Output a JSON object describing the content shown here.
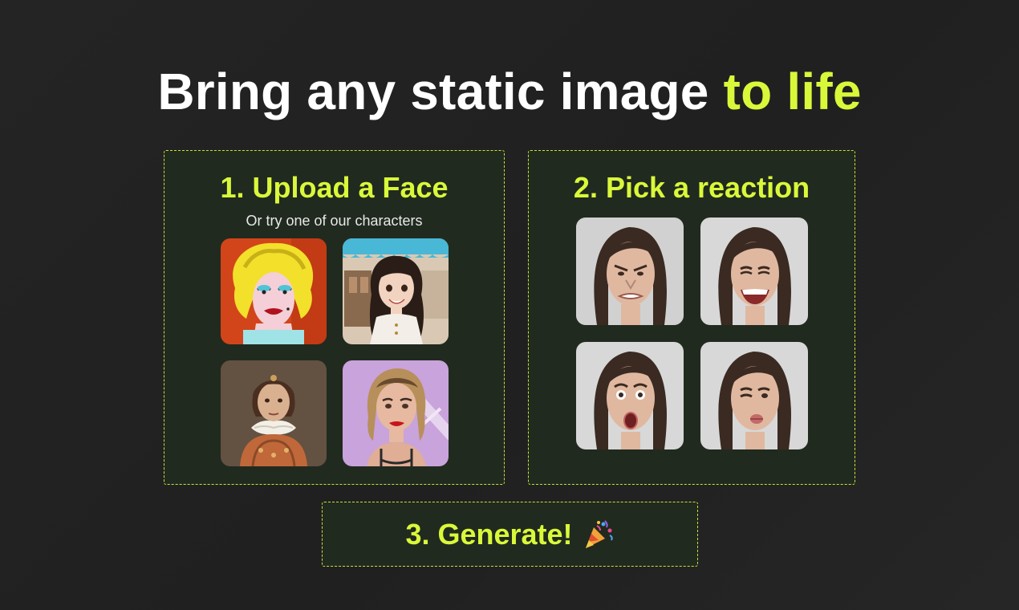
{
  "headline": {
    "main": "Bring any static image ",
    "accent": "to life"
  },
  "step1": {
    "title": "1. Upload a Face",
    "subtitle": "Or try one of our characters"
  },
  "step2": {
    "title": "2. Pick a reaction"
  },
  "step3": {
    "label": "3. Generate!"
  },
  "colors": {
    "accent": "#d9f83a",
    "background": "#222222",
    "panel": "#212a1f"
  },
  "icons": {
    "generate": "party-popper-icon"
  }
}
